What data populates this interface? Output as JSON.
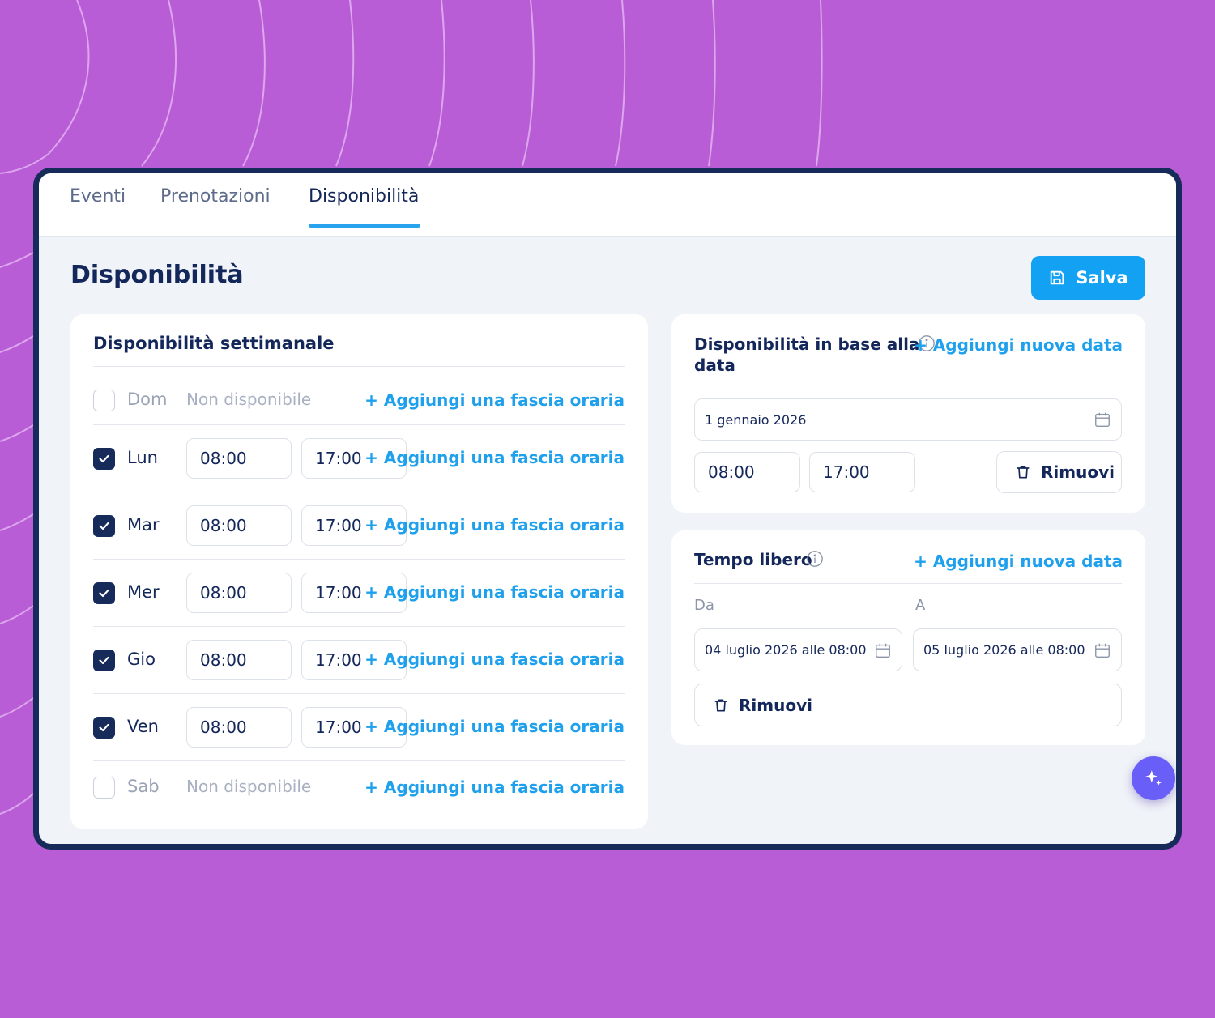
{
  "tabs": [
    {
      "label": "Eventi",
      "active": false
    },
    {
      "label": "Prenotazioni",
      "active": false
    },
    {
      "label": "Disponibilità",
      "active": true
    }
  ],
  "page_title": "Disponibilità",
  "save_label": "Salva",
  "weekly": {
    "title": "Disponibilità settimanale",
    "add_label": "+ Aggiungi una fascia oraria",
    "unavailable_label": "Non disponibile",
    "days": [
      {
        "label": "Dom",
        "checked": false
      },
      {
        "label": "Lun",
        "checked": true,
        "from": "08:00",
        "to": "17:00"
      },
      {
        "label": "Mar",
        "checked": true,
        "from": "08:00",
        "to": "17:00"
      },
      {
        "label": "Mer",
        "checked": true,
        "from": "08:00",
        "to": "17:00"
      },
      {
        "label": "Gio",
        "checked": true,
        "from": "08:00",
        "to": "17:00"
      },
      {
        "label": "Ven",
        "checked": true,
        "from": "08:00",
        "to": "17:00"
      },
      {
        "label": "Sab",
        "checked": false
      }
    ]
  },
  "date_based": {
    "title_line1": "Disponibilità in base alla",
    "title_line2": "data",
    "add_label": "+ Aggiungi nuova data",
    "date": "1 gennaio 2026",
    "from": "08:00",
    "to": "17:00",
    "remove_label": "Rimuovi"
  },
  "free_time": {
    "title": "Tempo libero",
    "add_label": "+ Aggiungi nuova data",
    "from_label": "Da",
    "to_label": "A",
    "from_value": "04 luglio 2026 alle 08:00",
    "to_value": "05 luglio 2026 alle 08:00",
    "remove_label": "Rimuovi"
  },
  "colors": {
    "background": "#b95dd6",
    "navy": "#14275a",
    "accent": "#12a1f3",
    "fab": "#6a5ef8"
  }
}
